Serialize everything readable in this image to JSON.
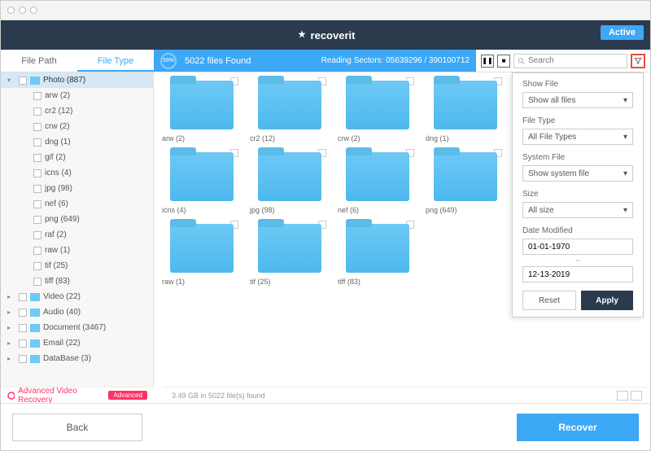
{
  "app": {
    "name": "recoverit",
    "active_badge": "Active"
  },
  "tabs": {
    "file_path": "File Path",
    "file_type": "File Type"
  },
  "scan": {
    "percent": "59%",
    "found": "5022 files Found",
    "sectors_label": "Reading Sectors:",
    "sectors": "05639296 / 390100712"
  },
  "search": {
    "placeholder": "Search"
  },
  "sidebar": {
    "photo": {
      "label": "Photo (887)"
    },
    "photo_items": [
      "arw (2)",
      "cr2 (12)",
      "crw (2)",
      "dng (1)",
      "gif (2)",
      "icns (4)",
      "jpg (98)",
      "nef (6)",
      "png (649)",
      "raf (2)",
      "raw (1)",
      "tif (25)",
      "tiff (83)"
    ],
    "video": "Video (22)",
    "audio": "Audio (40)",
    "document": "Document (3467)",
    "email": "Email (22)",
    "database": "DataBase (3)"
  },
  "adv": {
    "label": "Advanced Video Recovery",
    "badge": "Advanced"
  },
  "folders": [
    {
      "label": "arw (2)"
    },
    {
      "label": "cr2 (12)"
    },
    {
      "label": "crw (2)"
    },
    {
      "label": "dng (1)"
    },
    {
      "label": "icns (4)"
    },
    {
      "label": "jpg (98)"
    },
    {
      "label": "nef (6)"
    },
    {
      "label": "png (649)"
    },
    {
      "label": "raw (1)"
    },
    {
      "label": "tif (25)"
    },
    {
      "label": "tiff (83)"
    }
  ],
  "stats": "3.49 GB in 5022 file(s) found",
  "filter": {
    "show_file_label": "Show File",
    "show_file_value": "Show all files",
    "file_type_label": "File Type",
    "file_type_value": "All File Types",
    "system_file_label": "System File",
    "system_file_value": "Show system file",
    "size_label": "Size",
    "size_value": "All size",
    "date_label": "Date Modified",
    "date_from": "01-01-1970",
    "date_to": "12-13-2019",
    "reset": "Reset",
    "apply": "Apply"
  },
  "footer": {
    "back": "Back",
    "recover": "Recover"
  }
}
